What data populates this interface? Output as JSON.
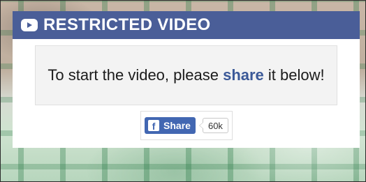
{
  "header": {
    "title": "RESTRICTED VIDEO",
    "icon": "video-play-icon",
    "background": "#4a5e98"
  },
  "message": {
    "before": "To start the video, please ",
    "highlight": "share",
    "after": " it below!",
    "highlight_color": "#3b5998"
  },
  "share": {
    "label": "Share",
    "count": "60k",
    "icon": "facebook-icon",
    "icon_letter": "f",
    "button_color": "#4267b2"
  }
}
